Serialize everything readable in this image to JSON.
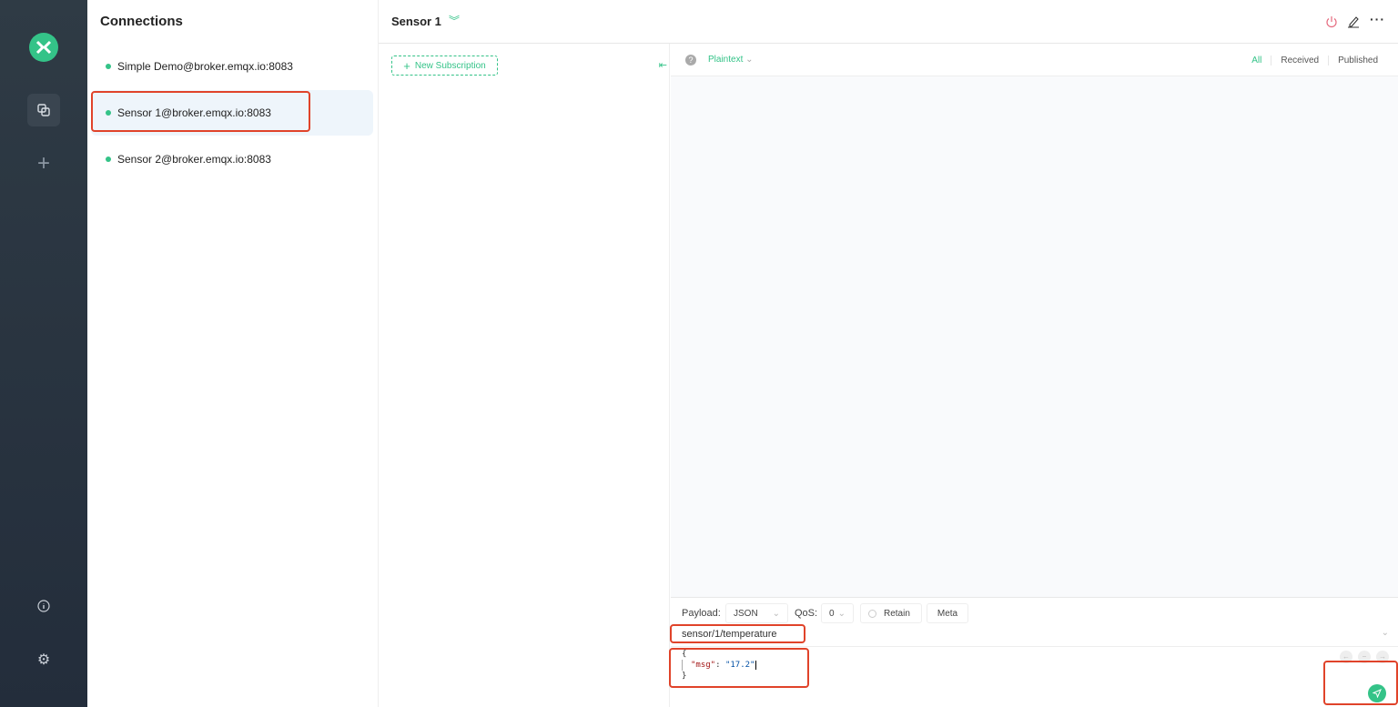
{
  "sidebar": {
    "icons": [
      "logo",
      "connections-icon",
      "plus-icon",
      "info-icon",
      "gear-icon"
    ]
  },
  "connections": {
    "title": "Connections",
    "items": [
      {
        "label": "Simple Demo@broker.emqx.io:8083",
        "status": "connected"
      },
      {
        "label": "Sensor 1@broker.emqx.io:8083",
        "status": "connected",
        "selected": true
      },
      {
        "label": "Sensor 2@broker.emqx.io:8083",
        "status": "connected"
      }
    ]
  },
  "header": {
    "title": "Sensor 1"
  },
  "subscriptions": {
    "new_label": "New Subscription"
  },
  "messages": {
    "format": "Plaintext",
    "tabs": [
      "All",
      "Received",
      "Published"
    ],
    "active_tab": "All"
  },
  "publish": {
    "payload_label": "Payload:",
    "payload_type": "JSON",
    "qos_label": "QoS:",
    "qos": "0",
    "retain_label": "Retain",
    "meta_label": "Meta",
    "topic": "sensor/1/temperature",
    "code": {
      "open": "{",
      "key": "\"msg\"",
      "colon": ": ",
      "value": "\"17.2\"",
      "close": "}"
    }
  },
  "colors": {
    "accent": "#34c388",
    "highlight": "#e0432a",
    "nav_bg": "#2b3641"
  }
}
